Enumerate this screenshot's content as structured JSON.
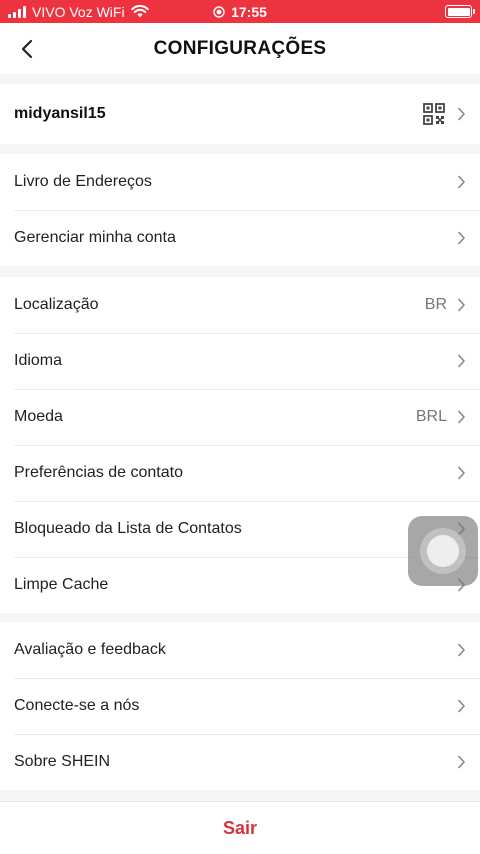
{
  "status_bar": {
    "carrier": "VIVO Voz WiFi",
    "time": "17:55"
  },
  "header": {
    "title": "CONFIGURAÇÕES"
  },
  "account": {
    "username": "midyansil15"
  },
  "sections": {
    "account_settings": [
      {
        "label": "Livro de Endereços"
      },
      {
        "label": "Gerenciar minha conta"
      }
    ],
    "preferences": [
      {
        "label": "Localização",
        "value": "BR"
      },
      {
        "label": "Idioma"
      },
      {
        "label": "Moeda",
        "value": "BRL"
      },
      {
        "label": "Preferências de contato"
      },
      {
        "label": "Bloqueado da Lista de Contatos"
      },
      {
        "label": "Limpe Cache"
      }
    ],
    "about": [
      {
        "label": "Avaliação e feedback"
      },
      {
        "label": "Conecte-se a nós"
      },
      {
        "label": "Sobre SHEIN"
      }
    ]
  },
  "logout": {
    "label": "Sair"
  },
  "colors": {
    "status_bar": "#ee3340",
    "accent_red": "#d8323d",
    "background": "#f6f6f6"
  }
}
